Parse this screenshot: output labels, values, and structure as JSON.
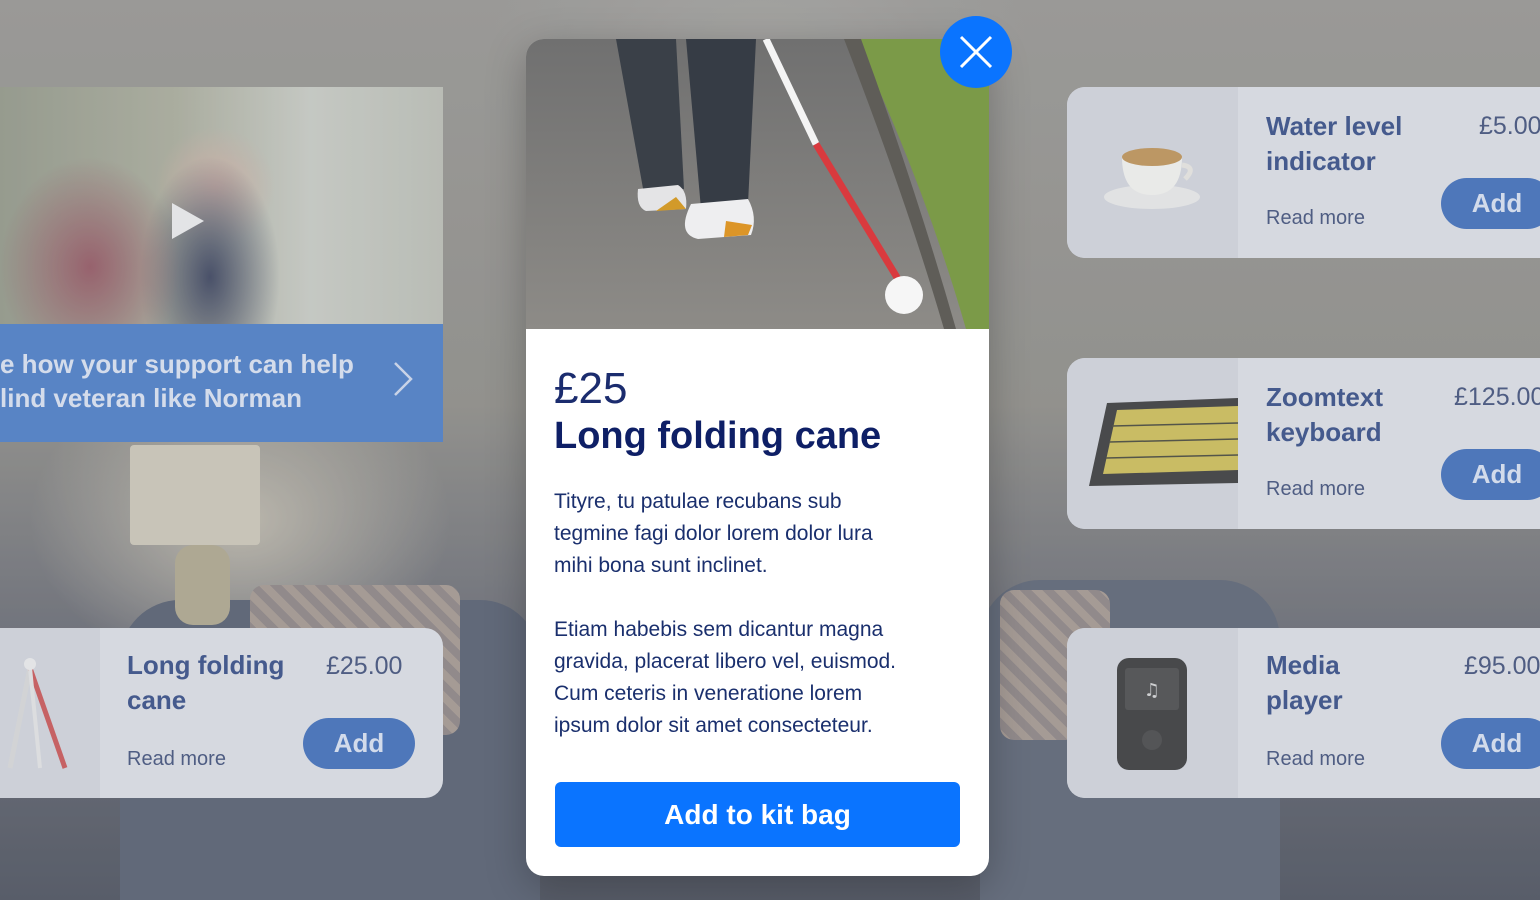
{
  "video_card": {
    "line1": "e how your support can help",
    "line2": "lind veteran like Norman"
  },
  "products": [
    {
      "name_line1": "Water level",
      "name_line2": "indicator",
      "price": "£5.00",
      "read_more": "Read more",
      "add": "Add"
    },
    {
      "name_line1": "Zoomtext",
      "name_line2": "keyboard",
      "price": "£125.00",
      "read_more": "Read more",
      "add": "Add"
    },
    {
      "name_line1": "Long folding",
      "name_line2": "cane",
      "price": "£25.00",
      "read_more": "Read more",
      "add": "Add"
    },
    {
      "name_line1": "Media",
      "name_line2": "player",
      "price": "£95.00",
      "read_more": "Read more",
      "add": "Add"
    }
  ],
  "modal": {
    "price": "£25",
    "title": "Long folding cane",
    "paragraph1_lines": [
      "Tityre, tu patulae recubans sub",
      "tegmine fagi dolor lorem dolor lura",
      "mihi bona sunt inclinet."
    ],
    "paragraph2_lines": [
      "Etiam habebis sem dicantur magna",
      "gravida, placerat libero vel, euismod.",
      "Cum ceteris in veneratione lorem",
      "ipsum dolor sit amet consecteteur."
    ],
    "cta": "Add to kit bag"
  },
  "icons": {
    "close": "close-icon",
    "play": "play-icon",
    "chevron": "chevron-right-icon"
  },
  "colors": {
    "accent": "#0a74ff",
    "heading": "#0e1f66"
  }
}
